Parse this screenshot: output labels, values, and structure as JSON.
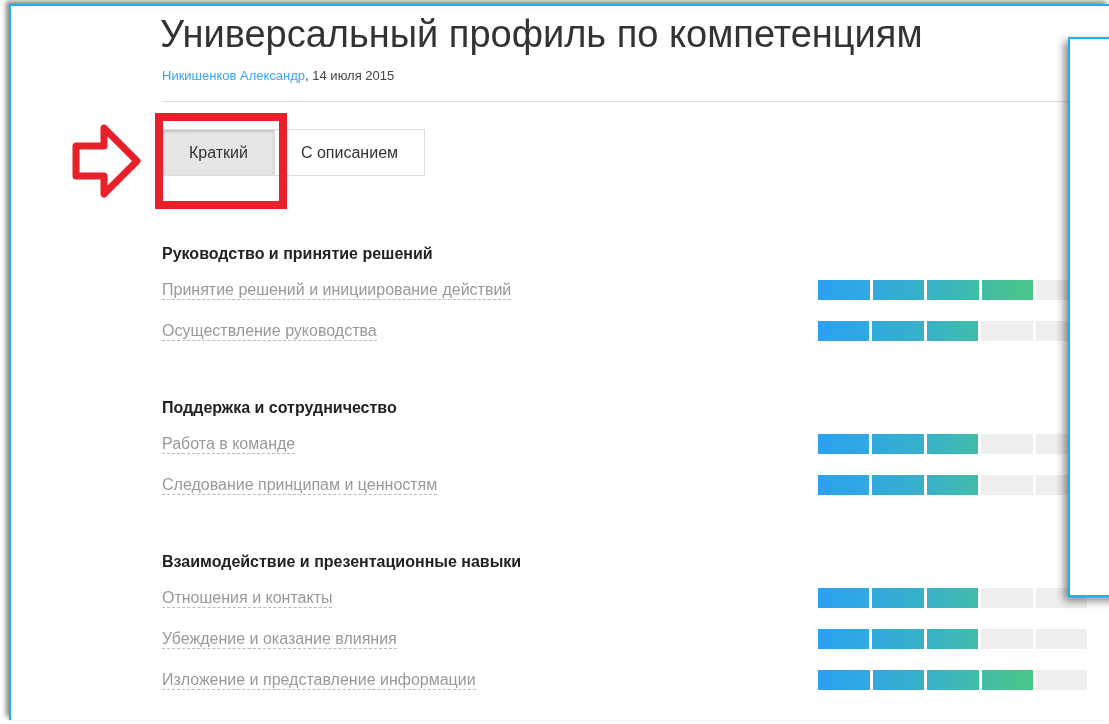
{
  "title": "Универсальный профиль по компетенциям",
  "author": "Никишенков Александр",
  "date": ", 14 июля 2015",
  "views": [
    {
      "label": "Краткий",
      "selected": true
    },
    {
      "label": "С описанием",
      "selected": false
    }
  ],
  "groups": [
    {
      "title": "Руководство и принятие решений",
      "items": [
        {
          "name": "Принятие решений и инициирование действий",
          "level": 0.8
        },
        {
          "name": "Осуществление руководства",
          "level": 0.6
        }
      ]
    },
    {
      "title": "Поддержка и сотрудничество",
      "items": [
        {
          "name": "Работа в команде",
          "level": 0.6
        },
        {
          "name": "Следование принципам и ценностям",
          "level": 0.6
        }
      ]
    },
    {
      "title": "Взаимодействие и презентационные навыки",
      "items": [
        {
          "name": "Отношения и контакты",
          "level": 0.6
        },
        {
          "name": "Убеждение и оказание влияния",
          "level": 0.6
        },
        {
          "name": "Изложение и представление информации",
          "level": 0.8
        }
      ]
    }
  ]
}
